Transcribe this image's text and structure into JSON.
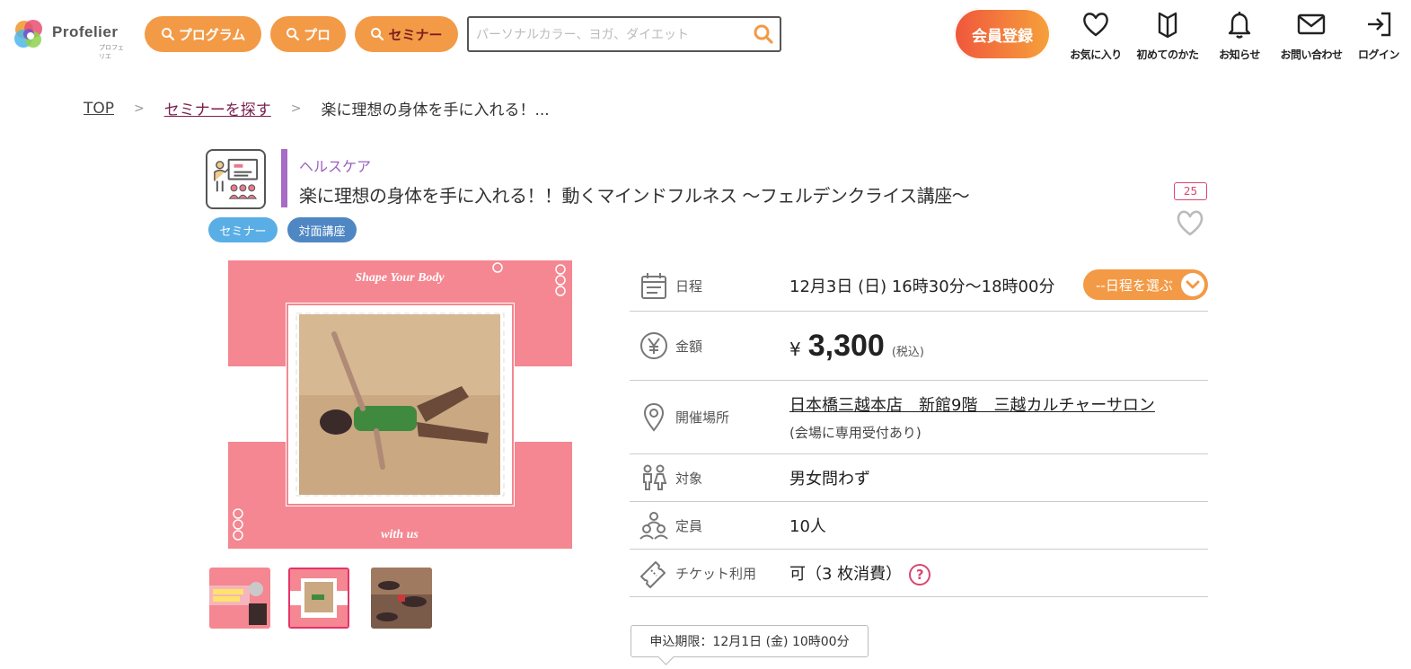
{
  "header": {
    "logo_text": "Profelier",
    "logo_sub": "プロフェリエ",
    "pills": [
      {
        "label": "プログラム"
      },
      {
        "label": "プロ"
      },
      {
        "label": "セミナー"
      }
    ],
    "search_placeholder": "パーソナルカラー、ヨガ、ダイエット",
    "register_label": "会員登録",
    "nav": [
      {
        "label": "お気に入り",
        "icon": "heart-icon"
      },
      {
        "label": "初めてのかた",
        "icon": "book-icon"
      },
      {
        "label": "お知らせ",
        "icon": "bell-icon"
      },
      {
        "label": "お問い合わせ",
        "icon": "mail-icon"
      },
      {
        "label": "ログイン",
        "icon": "login-icon"
      }
    ]
  },
  "breadcrumb": {
    "top": "TOP",
    "seminar": "セミナーを探す",
    "current": "楽に理想の身体を手に入れる！..."
  },
  "seminar": {
    "category": "ヘルスケア",
    "title": "楽に理想の身体を手に入れる！！動くマインドフルネス 〜フェルデンクライス講座〜",
    "badges": [
      "セミナー",
      "対面講座"
    ],
    "favorite_count": "25",
    "image_text_top": "Shape Your Body",
    "image_text_bottom": "with us"
  },
  "info": {
    "schedule": {
      "label": "日程",
      "value": "12月3日 (日) 16時30分〜18時00分",
      "button": "--日程を選ぶ"
    },
    "price": {
      "label": "金額",
      "currency": "¥",
      "amount": "3,300",
      "tax": "(税込)"
    },
    "venue": {
      "label": "開催場所",
      "value": "日本橋三越本店　新館9階　三越カルチャーサロン",
      "note": "(会場に専用受付あり)"
    },
    "target": {
      "label": "対象",
      "value": "男女問わず"
    },
    "capacity": {
      "label": "定員",
      "value": "10人"
    },
    "ticket": {
      "label": "チケット利用",
      "value": "可（3 枚消費）",
      "help": "?"
    }
  },
  "deadline": "申込期限：12月1日 (金) 10時00分",
  "colors": {
    "accent": "#f39a46",
    "category": "#9a62be",
    "pink": "#d9466f",
    "badge_seminar": "#5aaee6",
    "badge_face": "#4f87c4",
    "image_bg": "#f48791"
  }
}
